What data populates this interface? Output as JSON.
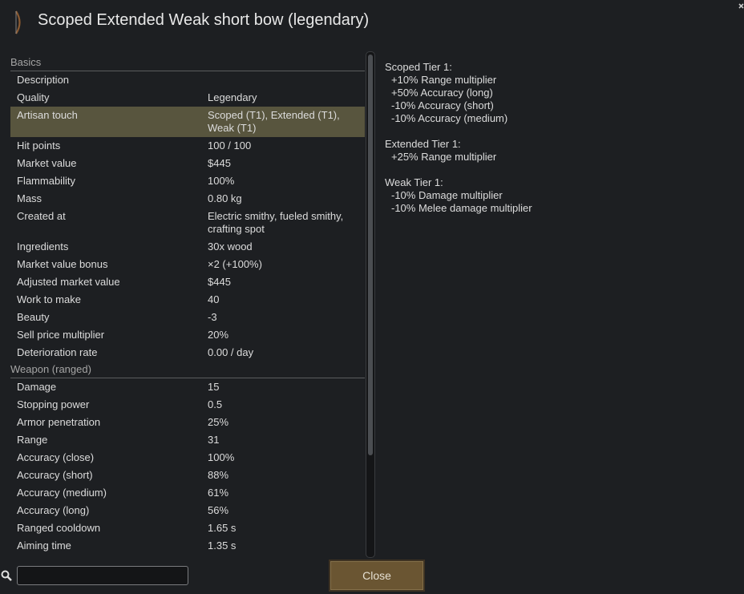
{
  "header": {
    "title": "Scoped Extended Weak short bow (legendary)",
    "icon": "short-bow-icon"
  },
  "sections": [
    {
      "title": "Basics",
      "rows": [
        {
          "label": "Description",
          "value": ""
        },
        {
          "label": "Quality",
          "value": "Legendary"
        },
        {
          "label": "Artisan touch",
          "value": "Scoped (T1), Extended (T1), Weak (T1)",
          "highlighted": true
        },
        {
          "label": "Hit points",
          "value": "100 / 100"
        },
        {
          "label": "Market value",
          "value": "$445"
        },
        {
          "label": "Flammability",
          "value": "100%"
        },
        {
          "label": "Mass",
          "value": "0.80 kg"
        },
        {
          "label": "Created at",
          "value": "Electric smithy, fueled smithy, crafting spot"
        },
        {
          "label": "Ingredients",
          "value": "30x wood"
        },
        {
          "label": "Market value bonus",
          "value": "×2  (+100%)"
        },
        {
          "label": "Adjusted market value",
          "value": "$445"
        },
        {
          "label": "Work to make",
          "value": "40"
        },
        {
          "label": "Beauty",
          "value": "-3"
        },
        {
          "label": "Sell price multiplier",
          "value": "20%"
        },
        {
          "label": "Deterioration rate",
          "value": "0.00 / day"
        }
      ]
    },
    {
      "title": "Weapon (ranged)",
      "rows": [
        {
          "label": "Damage",
          "value": "15"
        },
        {
          "label": "Stopping power",
          "value": "0.5"
        },
        {
          "label": "Armor penetration",
          "value": "25%"
        },
        {
          "label": "Range",
          "value": "31"
        },
        {
          "label": "Accuracy (close)",
          "value": "100%"
        },
        {
          "label": "Accuracy (short)",
          "value": "88%"
        },
        {
          "label": "Accuracy (medium)",
          "value": "61%"
        },
        {
          "label": "Accuracy (long)",
          "value": "56%"
        },
        {
          "label": "Ranged cooldown",
          "value": "1.65 s"
        },
        {
          "label": "Aiming time",
          "value": "1.35 s"
        }
      ]
    }
  ],
  "description": [
    {
      "heading": "Scoped Tier 1:",
      "lines": [
        "+10% Range multiplier",
        "+50% Accuracy (long)",
        "-10% Accuracy (short)",
        "-10% Accuracy (medium)"
      ]
    },
    {
      "heading": "Extended Tier 1:",
      "lines": [
        "+25% Range multiplier"
      ]
    },
    {
      "heading": "Weak Tier 1:",
      "lines": [
        "-10% Damage multiplier",
        "-10% Melee damage multiplier"
      ]
    }
  ],
  "search": {
    "value": "",
    "placeholder": ""
  },
  "footer": {
    "close_label": "Close"
  },
  "colors": {
    "background": "#1d1f22",
    "highlight_row": "#58553e",
    "button": "#6a5532"
  }
}
